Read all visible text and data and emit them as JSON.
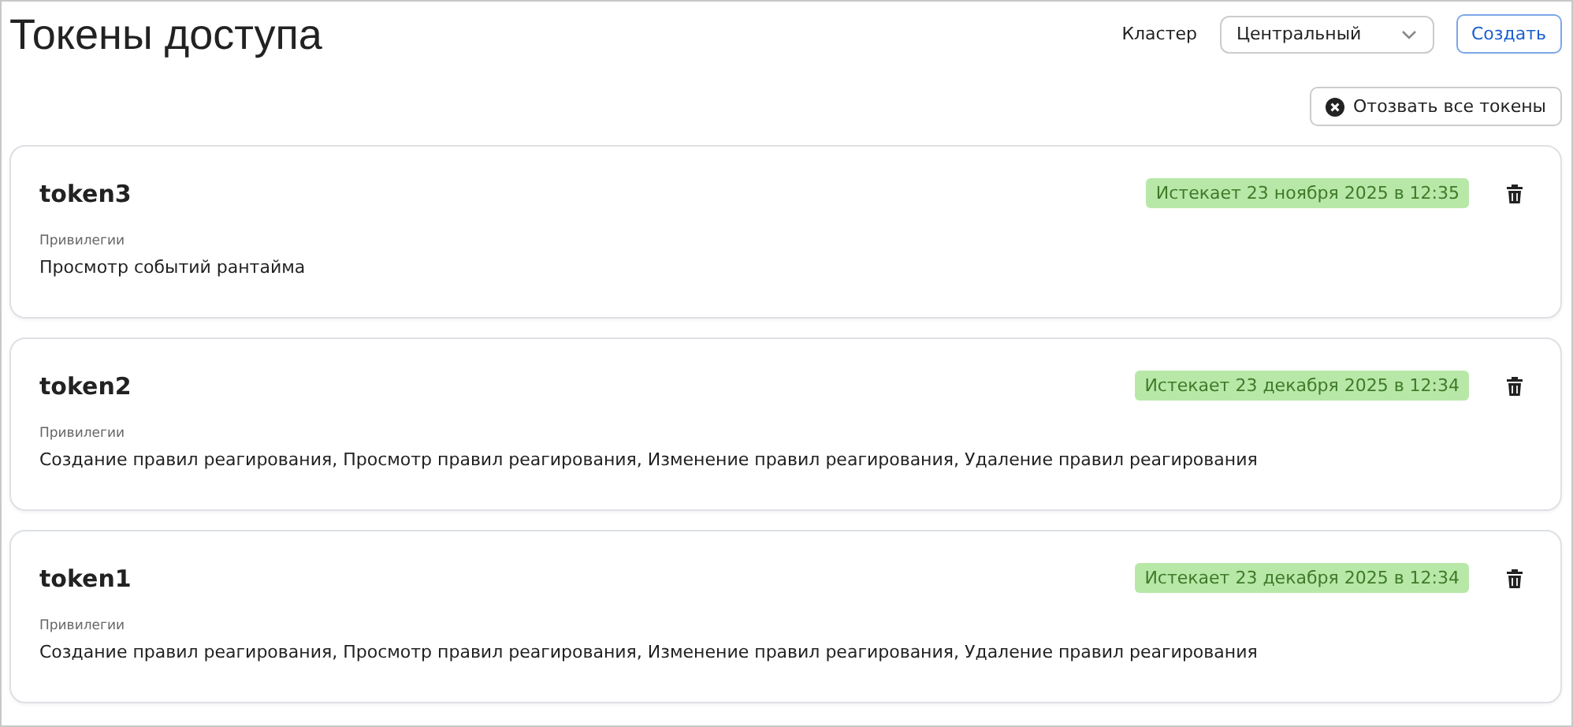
{
  "header": {
    "title": "Токены доступа",
    "cluster_label": "Кластер",
    "cluster_select": {
      "value": "Центральный"
    },
    "create_button": "Создать",
    "revoke_all_button": "Отозвать все токены"
  },
  "tokens": [
    {
      "name": "token3",
      "expires": "Истекает 23 ноября 2025 в 12:35",
      "privileges_label": "Привилегии",
      "privileges": "Просмотр событий рантайма"
    },
    {
      "name": "token2",
      "expires": "Истекает 23 декабря 2025 в 12:34",
      "privileges_label": "Привилегии",
      "privileges": "Создание правил реагирования, Просмотр правил реагирования, Изменение правил реагирования, Удаление правил реагирования"
    },
    {
      "name": "token1",
      "expires": "Истекает 23 декабря 2025 в 12:34",
      "privileges_label": "Привилегии",
      "privileges": "Создание правил реагирования, Просмотр правил реагирования, Изменение правил реагирования, Удаление правил реагирования"
    }
  ]
}
